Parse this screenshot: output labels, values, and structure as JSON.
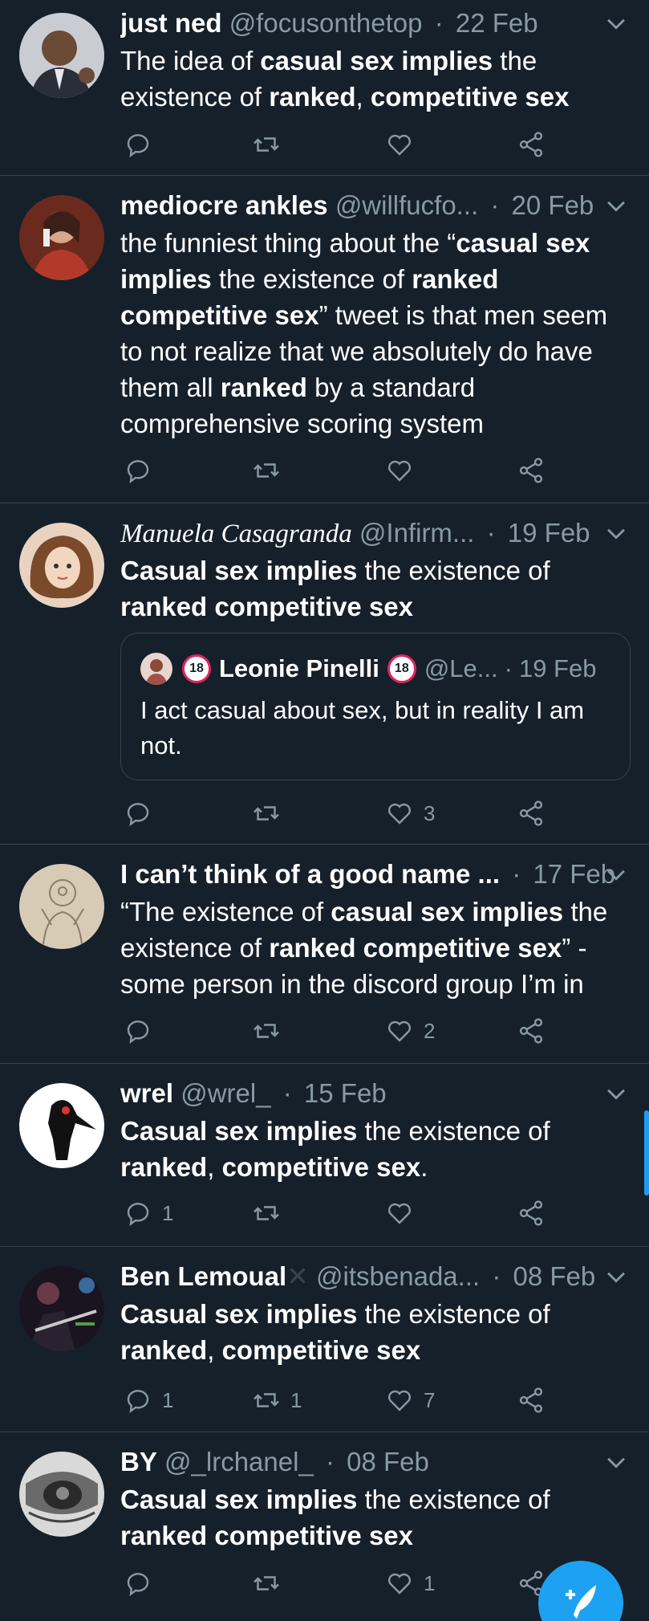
{
  "tweets": [
    {
      "name": "just ned",
      "handle": "@focusonthetop",
      "date": "22 Feb",
      "body_parts": [
        {
          "t": "The idea of ",
          "b": false
        },
        {
          "t": "casual sex implies",
          "b": true
        },
        {
          "t": " the existence of ",
          "b": false
        },
        {
          "t": "ranked",
          "b": true
        },
        {
          "t": ", ",
          "b": false
        },
        {
          "t": "competitive sex",
          "b": true
        }
      ],
      "counts": {
        "reply": "",
        "retweet": "",
        "like": ""
      }
    },
    {
      "name": "mediocre ankles",
      "handle": "@willfucfo...",
      "date": "20 Feb",
      "body_parts": [
        {
          "t": "the funniest thing about the “",
          "b": false
        },
        {
          "t": "casual sex implies",
          "b": true
        },
        {
          "t": " the existence of ",
          "b": false
        },
        {
          "t": "ranked competitive sex",
          "b": true
        },
        {
          "t": "” tweet is that men seem to not realize that we absolutely do have them all ",
          "b": false
        },
        {
          "t": "ranked",
          "b": true
        },
        {
          "t": " by a standard comprehensive scoring system",
          "b": false
        }
      ],
      "counts": {
        "reply": "",
        "retweet": "",
        "like": ""
      }
    },
    {
      "name": "Manuela Casagranda",
      "handle": "@Infirm...",
      "date": "19 Feb",
      "body_parts": [
        {
          "t": "Casual sex implies",
          "b": true
        },
        {
          "t": " the existence of ",
          "b": false
        },
        {
          "t": "ranked competitive sex",
          "b": true
        }
      ],
      "quote": {
        "badge": "18",
        "name": "Leonie Pinelli",
        "handle": "@Le...",
        "date": "19 Feb",
        "body": "I act casual about sex, but in reality I am not."
      },
      "counts": {
        "reply": "",
        "retweet": "",
        "like": "3"
      }
    },
    {
      "name": "I can’t think of a good name ...",
      "handle": "",
      "date": "17 Feb",
      "body_parts": [
        {
          "t": "“The existence of ",
          "b": false
        },
        {
          "t": "casual sex implies",
          "b": true
        },
        {
          "t": " the existence of ",
          "b": false
        },
        {
          "t": "ranked competitive sex",
          "b": true
        },
        {
          "t": "” - some person in the discord group I’m in",
          "b": false
        }
      ],
      "counts": {
        "reply": "",
        "retweet": "",
        "like": "2"
      }
    },
    {
      "name": "wrel",
      "handle": "@wrel_",
      "date": "15 Feb",
      "body_parts": [
        {
          "t": "Casual sex implies",
          "b": true
        },
        {
          "t": " the existence of ",
          "b": false
        },
        {
          "t": "ranked",
          "b": true
        },
        {
          "t": ", ",
          "b": false
        },
        {
          "t": "competitive sex",
          "b": true
        },
        {
          "t": ".",
          "b": false
        }
      ],
      "counts": {
        "reply": "1",
        "retweet": "",
        "like": ""
      }
    },
    {
      "name": "Ben Lemoual",
      "name_suffix": "✕",
      "handle": "@itsbenada...",
      "date": "08 Feb",
      "body_parts": [
        {
          "t": "Casual sex implies",
          "b": true
        },
        {
          "t": " the existence of ",
          "b": false
        },
        {
          "t": "ranked",
          "b": true
        },
        {
          "t": ", ",
          "b": false
        },
        {
          "t": "competitive sex",
          "b": true
        }
      ],
      "counts": {
        "reply": "1",
        "retweet": "1",
        "like": "7"
      }
    },
    {
      "name": "BY",
      "handle": "@_lrchanel_",
      "date": "08 Feb",
      "body_parts": [
        {
          "t": "Casual sex implies",
          "b": true
        },
        {
          "t": " the existence of ",
          "b": false
        },
        {
          "t": "ranked competitive sex",
          "b": true
        }
      ],
      "counts": {
        "reply": "",
        "retweet": "",
        "like": "1"
      }
    }
  ],
  "separator": "·",
  "icons": {
    "reply": "reply-icon",
    "retweet": "retweet-icon",
    "like": "heart-icon",
    "share": "share-icon",
    "menu": "chevron-down-icon",
    "compose": "compose-tweet-icon"
  },
  "colors": {
    "background": "#15202b",
    "text": "#ffffff",
    "secondary": "#8899a6",
    "border": "#38444d",
    "accent": "#1da1f2"
  }
}
